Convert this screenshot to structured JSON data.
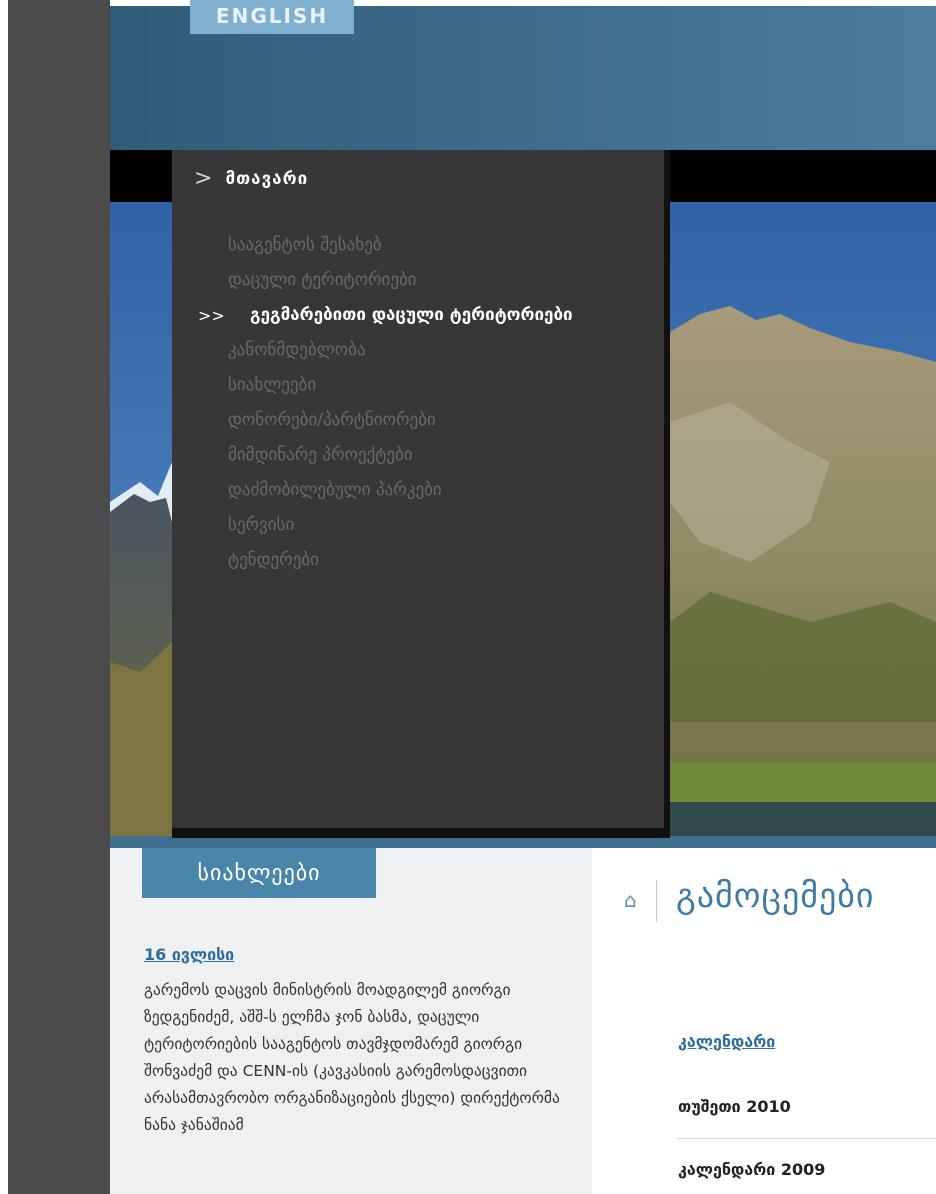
{
  "header": {
    "language_button": "ENGLISH"
  },
  "menu": {
    "heading": "მთავარი",
    "items": [
      {
        "label": "სააგენტოს შესახებ",
        "active": false
      },
      {
        "label": "დაცული ტერიტორიები",
        "active": false
      },
      {
        "label": "გეგმარებითი დაცული ტერიტორიები",
        "active": true
      },
      {
        "label": "კანონმდებლობა",
        "active": false
      },
      {
        "label": "სიახლეები",
        "active": false
      },
      {
        "label": "დონორები/პარტნიორები",
        "active": false
      },
      {
        "label": "მიმდინარე პროექტები",
        "active": false
      },
      {
        "label": "დაძმობილებული პარკები",
        "active": false
      },
      {
        "label": "სერვისი",
        "active": false
      },
      {
        "label": "ტენდერები",
        "active": false
      }
    ],
    "active_marker": ">>",
    "heading_marker": ">"
  },
  "news": {
    "tab_label": "სიახლეები",
    "date": "16 ივლისი",
    "text": "გარემოს დაცვის მინისტრის მოადგილემ გიორგი ზედგენიძემ, აშშ-ს ელჩმა ჯონ ბასმა, დაცული ტერიტორიების სააგენტოს თავმჯდომარემ გიორგი შონვაძემ და CENN-ის (კავკასიის გარემოსდაცვითი არასამთავრობო ორგანიზაციების ქსელი) დირექტორმა ნანა ჯანაშიამ"
  },
  "publications": {
    "title": "გამოცემები",
    "calendar_link": "კალენდარი",
    "rows": [
      "თუშეთი 2010",
      "კალენდარი 2009"
    ]
  },
  "colors": {
    "accent_blue": "#4a86a9",
    "link_blue": "#2e6d9c",
    "menu_bg": "#373737",
    "sidebar_gray": "#4b4b4b"
  }
}
